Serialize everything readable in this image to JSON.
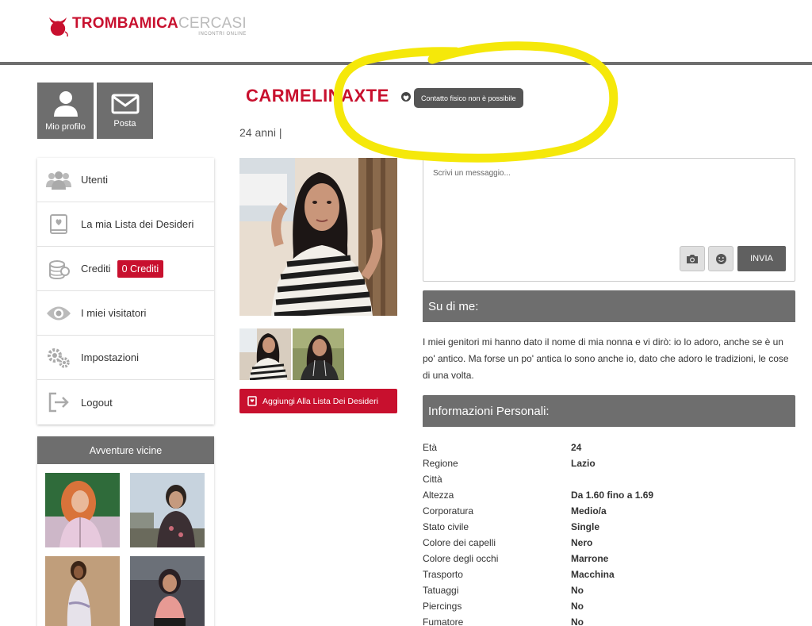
{
  "header": {
    "logo_main_a": "TROMBAMICA",
    "logo_main_b": "CERCASI",
    "logo_sub": "INCONTRI ONLINE"
  },
  "tiles": [
    {
      "label": "Mio profilo",
      "icon": "user-icon"
    },
    {
      "label": "Posta",
      "icon": "envelope-icon"
    }
  ],
  "menu": [
    {
      "label": "Utenti",
      "icon": "users-icon"
    },
    {
      "label": "La mia Lista dei Desideri",
      "icon": "wishlist-book-icon"
    },
    {
      "label": "Crediti",
      "icon": "coins-icon",
      "badge": "0 Crediti"
    },
    {
      "label": "I miei visitatori",
      "icon": "eye-icon"
    },
    {
      "label": "Impostazioni",
      "icon": "gears-icon"
    },
    {
      "label": "Logout",
      "icon": "logout-icon"
    }
  ],
  "nearby": {
    "title": "Avventure vicine"
  },
  "profile": {
    "name": "CARMELINAXTE",
    "contact_status": "Contatto fisico non è possibile",
    "age": "24 anni |",
    "wishlist_button": "Aggiungi Alla Lista Dei Desideri"
  },
  "message": {
    "placeholder": "Scrivi un messaggio...",
    "send_label": "INVIA"
  },
  "about": {
    "title": "Su di me:",
    "text": "I miei genitori mi hanno dato il nome di mia nonna e vi dirò: io lo adoro, anche se è un po' antico. Ma forse un po' antica lo sono anche io, dato che adoro le tradizioni, le cose di una volta."
  },
  "info": {
    "title": "Informazioni Personali:",
    "rows": [
      {
        "label": "Età",
        "value": "24"
      },
      {
        "label": "Regione",
        "value": "Lazio"
      },
      {
        "label": "Città",
        "value": ""
      },
      {
        "label": "Altezza",
        "value": "Da 1.60 fino a 1.69"
      },
      {
        "label": "Corporatura",
        "value": "Medio/a"
      },
      {
        "label": "Stato civile",
        "value": "Single"
      },
      {
        "label": "Colore dei capelli",
        "value": "Nero"
      },
      {
        "label": "Colore degli occhi",
        "value": "Marrone"
      },
      {
        "label": "Trasporto",
        "value": "Macchina"
      },
      {
        "label": "Tatuaggi",
        "value": "No"
      },
      {
        "label": "Piercings",
        "value": "No"
      },
      {
        "label": "Fumatore",
        "value": "No"
      }
    ]
  },
  "colors": {
    "brand": "#c8102e",
    "panel": "#6e6e6e",
    "highlight": "#f5e80a"
  }
}
